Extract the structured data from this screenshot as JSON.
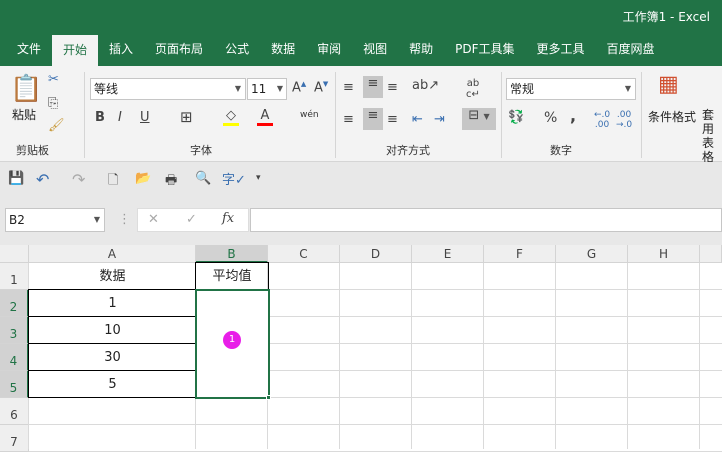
{
  "title": "工作簿1  -  Excel",
  "tabs": [
    "文件",
    "开始",
    "插入",
    "页面布局",
    "公式",
    "数据",
    "审阅",
    "视图",
    "帮助",
    "PDF工具集",
    "更多工具",
    "百度网盘"
  ],
  "active_tab": "开始",
  "ribbon": {
    "clipboard": {
      "paste": "粘贴",
      "group": "剪贴板"
    },
    "font": {
      "name": "等线",
      "size": "11",
      "group": "字体",
      "bold": "B",
      "italic": "I",
      "underline": "U",
      "phonetic": "wén"
    },
    "alignment": {
      "group": "对齐方式"
    },
    "number": {
      "format": "常规",
      "group": "数字",
      "percent": "%",
      "comma": ","
    },
    "styles": {
      "conditional": "条件格式",
      "table_fmt": "套用表格格式"
    },
    "colors": {
      "highlight": "#ffff00",
      "font_color": "#ff0000"
    }
  },
  "formula_bar": {
    "name_box": "B2",
    "fx": "fx",
    "value": ""
  },
  "columns": [
    "A",
    "B",
    "C",
    "D",
    "E",
    "F",
    "G",
    "H"
  ],
  "rows": [
    "1",
    "2",
    "3",
    "4",
    "5",
    "6",
    "7"
  ],
  "cells": {
    "A1": "数据",
    "B1": "平均值",
    "A2": "1",
    "A3": "10",
    "A4": "30",
    "A5": "5"
  },
  "selected": "B2",
  "marker": {
    "label": "1",
    "color": "#e81ee8"
  },
  "accent": "#217346"
}
